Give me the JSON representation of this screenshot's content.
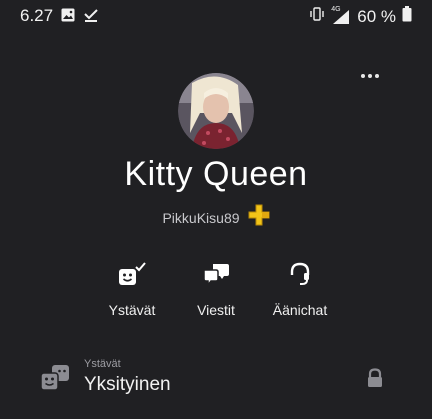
{
  "status_bar": {
    "time": "6.27",
    "network": "4G",
    "battery": "60 %",
    "icons": [
      "image-icon",
      "download-done-icon",
      "vibrate-icon",
      "signal-icon",
      "battery-icon"
    ]
  },
  "profile": {
    "display_name": "Kitty Queen",
    "online_id": "PikkuKisu89",
    "badge_icon": "ps-plus-icon",
    "badge_color": "#f2c418"
  },
  "actions": [
    {
      "label": "Ystävät",
      "icon": "friend-added-icon"
    },
    {
      "label": "Viestit",
      "icon": "messages-icon"
    },
    {
      "label": "Äänichat",
      "icon": "headset-icon"
    }
  ],
  "privacy": {
    "caption": "Ystävät",
    "value": "Yksityinen",
    "icon": "friends-masks-icon",
    "lock_icon": "lock-icon"
  },
  "colors": {
    "background": "#202023",
    "text": "#ffffff",
    "muted": "#9d9da3"
  }
}
